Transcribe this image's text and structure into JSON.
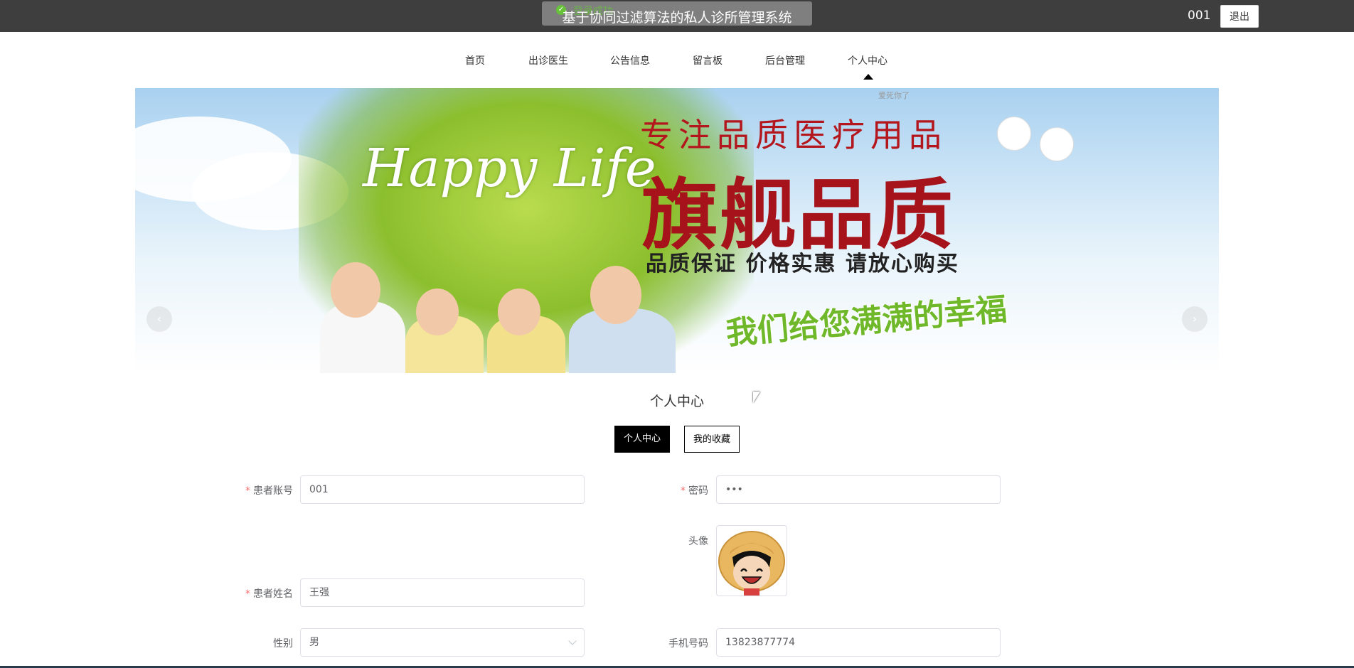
{
  "header": {
    "system_title": "基于协同过滤算法的私人诊所管理系统",
    "toast_message": "登录成功",
    "username": "001",
    "logout_label": "退出"
  },
  "nav": {
    "items": [
      {
        "label": "首页"
      },
      {
        "label": "出诊医生"
      },
      {
        "label": "公告信息"
      },
      {
        "label": "留言板"
      },
      {
        "label": "后台管理"
      },
      {
        "label": "个人中心"
      }
    ],
    "active": "个人中心"
  },
  "banner": {
    "happy_text": "Happy Life",
    "line1": "专注品质医疗用品",
    "line2": "旗舰品质",
    "line3": "品质保证 价格实惠 请放心购买",
    "line4": "我们给您满满的幸福",
    "tag": "爱死你了",
    "prev_icon": "‹",
    "next_icon": "›"
  },
  "section": {
    "title": "个人中心",
    "tabs": [
      {
        "label": "个人中心",
        "active": true
      },
      {
        "label": "我的收藏",
        "active": false
      }
    ]
  },
  "form": {
    "account_label": "患者账号",
    "account_value": "001",
    "password_label": "密码",
    "password_value": "•••",
    "avatar_label": "头像",
    "name_label": "患者姓名",
    "name_value": "王强",
    "gender_label": "性别",
    "gender_value": "男",
    "phone_label": "手机号码",
    "phone_value": "13823877774"
  }
}
